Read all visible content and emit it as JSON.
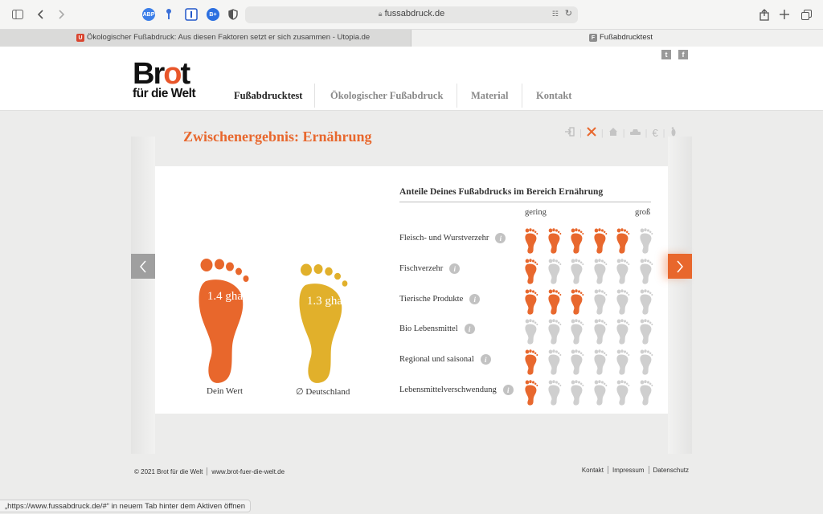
{
  "browser": {
    "url": "fussabdruck.de",
    "tabs": [
      {
        "title": "Ökologischer Fußabdruck: Aus diesen Faktoren setzt er sich zusammen - Utopia.de",
        "favicon": "U",
        "favicon_color": "#d9452f"
      },
      {
        "title": "Fußabdrucktest",
        "favicon": "F",
        "favicon_color": "#8c8c8c"
      }
    ],
    "extensions": [
      "ABP",
      "B+"
    ],
    "status_text": "„https://www.fussabdruck.de/#“ in neuem Tab hinter dem Aktiven öffnen"
  },
  "header": {
    "logo_word": "Brot",
    "logo_sub": "für die Welt",
    "social": [
      "t",
      "f"
    ],
    "nav": [
      "Fußabdrucktest",
      "Ökologischer Fußabdruck",
      "Material",
      "Kontakt"
    ]
  },
  "content": {
    "heading": "Zwischenergebnis: Ernährung",
    "step_icons": [
      "login-icon",
      "food-icon",
      "home-icon",
      "car-icon",
      "euro-icon",
      "footprint-icon"
    ],
    "euro_symbol": "€",
    "your_value": "1.4 gha",
    "your_label": "Dein Wert",
    "avg_value": "1.3 gha",
    "avg_label": "∅ Deutschland",
    "table_title": "Anteile Deines Fußabdrucks im Bereich Ernährung",
    "scale_low": "gering",
    "scale_high": "groß",
    "rows": [
      {
        "label": "Fleisch- und Wurstverzehr",
        "level": 5
      },
      {
        "label": "Fischverzehr",
        "level": 1
      },
      {
        "label": "Tierische Produkte",
        "level": 3
      },
      {
        "label": "Bio Lebensmittel",
        "level": 0
      },
      {
        "label": "Regional und saisonal",
        "level": 1
      },
      {
        "label": "Lebensmittelverschwendung",
        "level": 1
      }
    ],
    "scale_max": 6
  },
  "footer": {
    "copyright": "© 2021 Brot für die Welt",
    "site": "www.brot-fuer-die-welt.de",
    "links": [
      "Kontakt",
      "Impressum",
      "Datenschutz"
    ]
  },
  "colors": {
    "accent": "#e8682e",
    "avg": "#e2b02c",
    "inactive": "#cfcfcf"
  }
}
